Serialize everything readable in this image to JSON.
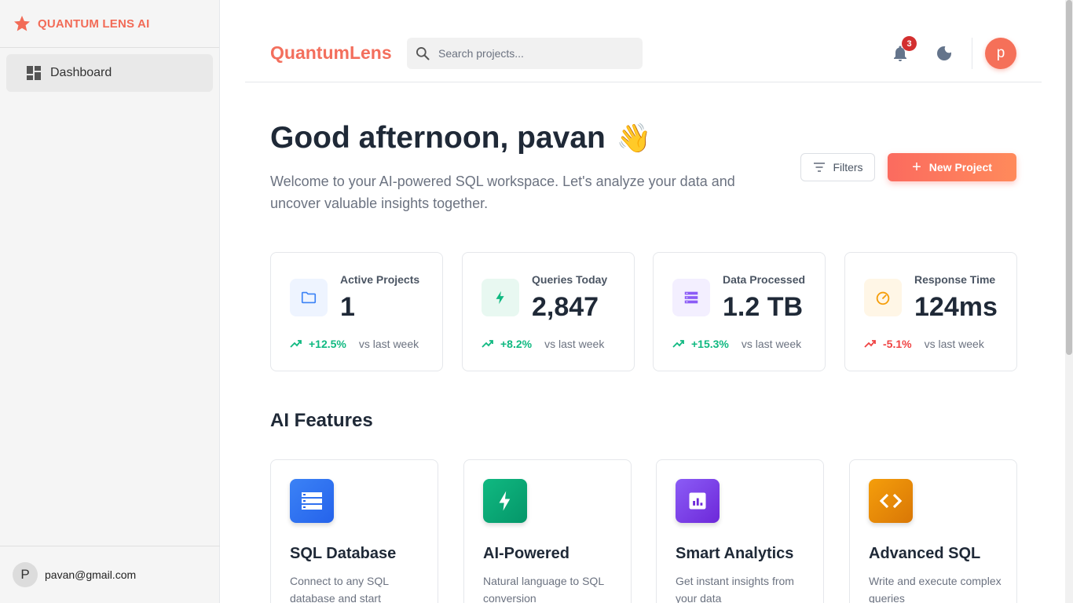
{
  "sidebar": {
    "brand": "QUANTUM LENS AI",
    "nav": [
      {
        "label": "Dashboard",
        "icon": "dashboard-icon"
      }
    ],
    "user": {
      "initial": "P",
      "email": "pavan@gmail.com"
    }
  },
  "header": {
    "logo": "QuantumLens",
    "search_placeholder": "Search projects...",
    "notification_count": "3",
    "avatar_initial": "p"
  },
  "greeting": {
    "title": "Good afternoon, pavan",
    "emoji": "👋",
    "subtitle": "Welcome to your AI-powered SQL workspace. Let's analyze your data and uncover valuable insights together.",
    "filters_label": "Filters",
    "new_project_label": "New Project"
  },
  "stats": [
    {
      "label": "Active Projects",
      "value": "1",
      "delta": "+12.5%",
      "vs": "vs last week",
      "trend": "up",
      "icon": "folder-icon",
      "color": "#3b82f6",
      "bg": "#eef4ff"
    },
    {
      "label": "Queries Today",
      "value": "2,847",
      "delta": "+8.2%",
      "vs": "vs last week",
      "trend": "up",
      "icon": "lightning-icon",
      "color": "#10b981",
      "bg": "#e8f8f1"
    },
    {
      "label": "Data Processed",
      "value": "1.2 TB",
      "delta": "+15.3%",
      "vs": "vs last week",
      "trend": "up",
      "icon": "storage-icon",
      "color": "#8b5cf6",
      "bg": "#f3efff"
    },
    {
      "label": "Response Time",
      "value": "124ms",
      "delta": "-5.1%",
      "vs": "vs last week",
      "trend": "down",
      "icon": "speedometer-icon",
      "color": "#f59e0b",
      "bg": "#fff6e6"
    }
  ],
  "features_title": "AI Features",
  "features": [
    {
      "title": "SQL Database",
      "desc": "Connect to any SQL database and start",
      "icon": "database-icon",
      "color": "#3b82f6"
    },
    {
      "title": "AI-Powered",
      "desc": "Natural language to SQL conversion",
      "icon": "lightning-icon",
      "color": "#10b981"
    },
    {
      "title": "Smart Analytics",
      "desc": "Get instant insights from your data",
      "icon": "analytics-icon",
      "color": "#7c3aed"
    },
    {
      "title": "Advanced SQL",
      "desc": "Write and execute complex queries",
      "icon": "code-icon",
      "color": "#f59e0b"
    }
  ],
  "colors": {
    "accent": "#f36f5d",
    "up": "#10b981",
    "down": "#ef4444"
  }
}
